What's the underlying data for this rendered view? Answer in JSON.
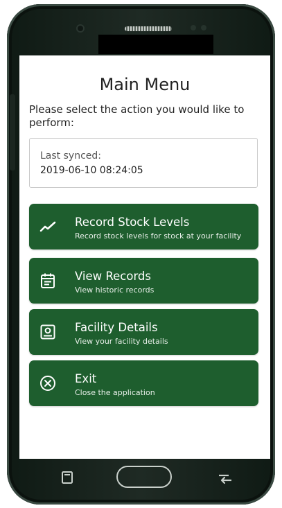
{
  "screen": {
    "title": "Main Menu",
    "subtitle": "Please select the action you would like to perform:"
  },
  "sync": {
    "label": "Last synced:",
    "value": "2019-06-10 08:24:05"
  },
  "menu": {
    "items": [
      {
        "title": "Record Stock Levels",
        "subtitle": "Record stock levels for stock at your facility",
        "icon": "trend-line-icon"
      },
      {
        "title": "View Records",
        "subtitle": "View historic records",
        "icon": "calendar-list-icon"
      },
      {
        "title": "Facility Details",
        "subtitle": "View your facility details",
        "icon": "id-badge-icon"
      },
      {
        "title": "Exit",
        "subtitle": "Close the application",
        "icon": "close-circle-icon"
      }
    ]
  },
  "colors": {
    "accent": "#1e5e2e",
    "phone_body": "#1a241f",
    "screen_bg": "#ffffff"
  }
}
